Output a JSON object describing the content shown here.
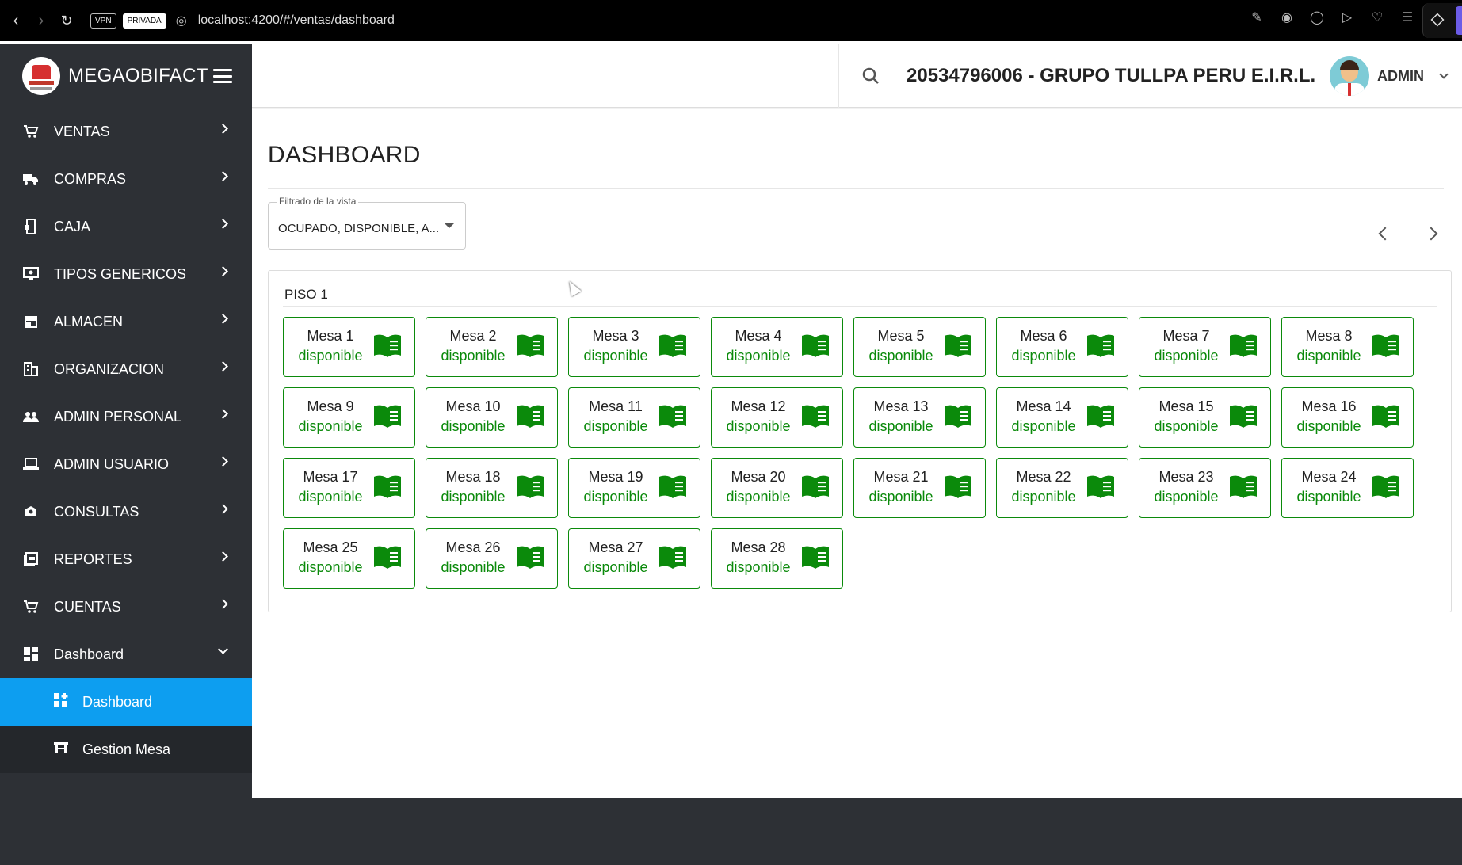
{
  "browser": {
    "url": "localhost:4200/#/ventas/dashboard",
    "badge_vpn": "VPN",
    "badge_private": "PRIVADA"
  },
  "brand": {
    "name": "MEGAOBIFACT"
  },
  "header": {
    "company": "20534796006 - GRUPO TULLPA PERU E.I.R.L.",
    "user": "ADMIN"
  },
  "sidebar": {
    "items": [
      {
        "label": "VENTAS",
        "icon": "cart-icon"
      },
      {
        "label": "COMPRAS",
        "icon": "truck-icon"
      },
      {
        "label": "CAJA",
        "icon": "cash-icon"
      },
      {
        "label": "TIPOS GENERICOS",
        "icon": "settings-monitor-icon"
      },
      {
        "label": "ALMACEN",
        "icon": "store-icon"
      },
      {
        "label": "ORGANIZACION",
        "icon": "building-icon"
      },
      {
        "label": "ADMIN PERSONAL",
        "icon": "people-icon"
      },
      {
        "label": "ADMIN USUARIO",
        "icon": "laptop-icon"
      },
      {
        "label": "CONSULTAS",
        "icon": "consult-icon"
      },
      {
        "label": "REPORTES",
        "icon": "pdf-icon"
      },
      {
        "label": "CUENTAS",
        "icon": "cart-icon"
      },
      {
        "label": "Dashboard",
        "icon": "dashboard-icon"
      }
    ],
    "subitems": [
      {
        "label": "Dashboard",
        "icon": "dashboard-add-icon"
      },
      {
        "label": "Gestion Mesa",
        "icon": "table-icon"
      }
    ]
  },
  "main": {
    "title": "DASHBOARD",
    "filter": {
      "label": "Filtrado de la vista",
      "value": "OCUPADO, DISPONIBLE, A..."
    },
    "floor": {
      "title": "PISO 1",
      "tables": [
        {
          "name": "Mesa 1",
          "status": "disponible"
        },
        {
          "name": "Mesa 2",
          "status": "disponible"
        },
        {
          "name": "Mesa 3",
          "status": "disponible"
        },
        {
          "name": "Mesa 4",
          "status": "disponible"
        },
        {
          "name": "Mesa 5",
          "status": "disponible"
        },
        {
          "name": "Mesa 6",
          "status": "disponible"
        },
        {
          "name": "Mesa 7",
          "status": "disponible"
        },
        {
          "name": "Mesa 8",
          "status": "disponible"
        },
        {
          "name": "Mesa 9",
          "status": "disponible"
        },
        {
          "name": "Mesa 10",
          "status": "disponible"
        },
        {
          "name": "Mesa 11",
          "status": "disponible"
        },
        {
          "name": "Mesa 12",
          "status": "disponible"
        },
        {
          "name": "Mesa 13",
          "status": "disponible"
        },
        {
          "name": "Mesa 14",
          "status": "disponible"
        },
        {
          "name": "Mesa 15",
          "status": "disponible"
        },
        {
          "name": "Mesa 16",
          "status": "disponible"
        },
        {
          "name": "Mesa 17",
          "status": "disponible"
        },
        {
          "name": "Mesa 18",
          "status": "disponible"
        },
        {
          "name": "Mesa 19",
          "status": "disponible"
        },
        {
          "name": "Mesa 20",
          "status": "disponible"
        },
        {
          "name": "Mesa 21",
          "status": "disponible"
        },
        {
          "name": "Mesa 22",
          "status": "disponible"
        },
        {
          "name": "Mesa 23",
          "status": "disponible"
        },
        {
          "name": "Mesa 24",
          "status": "disponible"
        },
        {
          "name": "Mesa 25",
          "status": "disponible"
        },
        {
          "name": "Mesa 26",
          "status": "disponible"
        },
        {
          "name": "Mesa 27",
          "status": "disponible"
        },
        {
          "name": "Mesa 28",
          "status": "disponible"
        }
      ]
    }
  },
  "colors": {
    "sidebar_bg": "#2d3035",
    "active_item": "#0d9ef0",
    "available": "#0b8a0b"
  }
}
